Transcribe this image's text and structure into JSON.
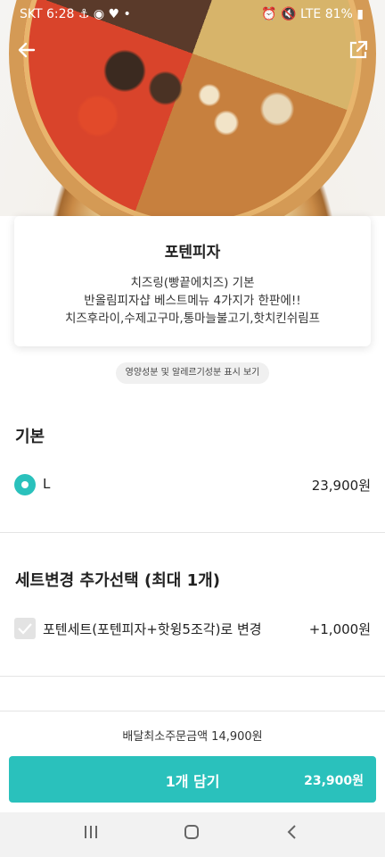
{
  "status_bar": {
    "left": "SKT 6:28 ⚓ ◉ ♥ •",
    "right": "⏰ 🔇 LTE 81% ▮"
  },
  "header": {
    "back_icon": "arrow-left-icon",
    "share_icon": "share-external-icon"
  },
  "product": {
    "name": "포텐피자",
    "desc_lines": [
      "치즈링(빵끝에치즈) 기본",
      "반올림피자샵 베스트메뉴 4가지가 한판에!!",
      "치즈후라이,수제고구마,통마늘불고기,핫치킨쉬림프"
    ]
  },
  "nutrition_button": "영양성분 및 알레르기성분 표시 보기",
  "basic": {
    "title": "기본",
    "option_label": "L",
    "option_price": "23,900원"
  },
  "set": {
    "title": "세트변경 추가선택 (최대 1개)",
    "option_label": "포텐세트(포텐피자+핫윙5조각)로 변경",
    "option_price": "+1,000원"
  },
  "min_order": "배달최소주문금액 14,900원",
  "cart": {
    "label": "1개 담기",
    "price": "23,900원"
  },
  "colors": {
    "accent": "#2ac1bc"
  }
}
